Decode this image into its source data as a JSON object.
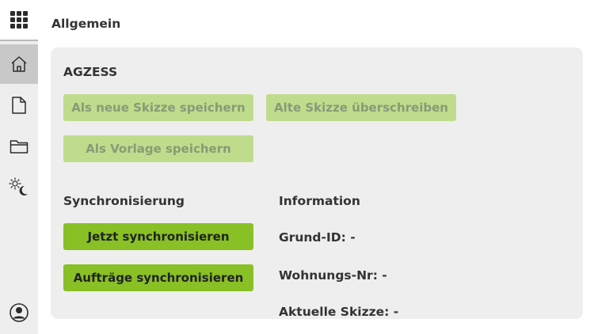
{
  "page": {
    "title": "Allgemein"
  },
  "nav": {
    "items": [
      {
        "name": "apps",
        "icon": "grid-icon",
        "active": false
      },
      {
        "name": "home",
        "icon": "home-icon",
        "active": true
      },
      {
        "name": "document",
        "icon": "file-icon",
        "active": false
      },
      {
        "name": "folder",
        "icon": "folder-icon",
        "active": false
      },
      {
        "name": "theme",
        "icon": "sun-moon-icon",
        "active": false
      },
      {
        "name": "profile",
        "icon": "user-circle-icon",
        "active": false
      }
    ]
  },
  "card": {
    "section_title": "AGZESS",
    "buttons": {
      "save_new": "Als neue Skizze speichern",
      "overwrite": "Alte Skizze überschreiben",
      "save_template": "Als Vorlage speichern"
    },
    "sync": {
      "title": "Synchronisierung",
      "sync_now": "Jetzt synchronisieren",
      "sync_orders": "Aufträge synchronisieren"
    },
    "info": {
      "title": "Information",
      "grund_id": "Grund-ID: -",
      "wohnungs_nr": "Wohnungs-Nr: -",
      "aktuelle_skizze": "Aktuelle Skizze: -"
    }
  },
  "colors": {
    "accent": "#88c025",
    "accent_disabled": "#bfdc8c",
    "rail_bg": "#eeeeee",
    "rail_active": "#c8c8c8",
    "card_bg": "#eeeeee"
  }
}
